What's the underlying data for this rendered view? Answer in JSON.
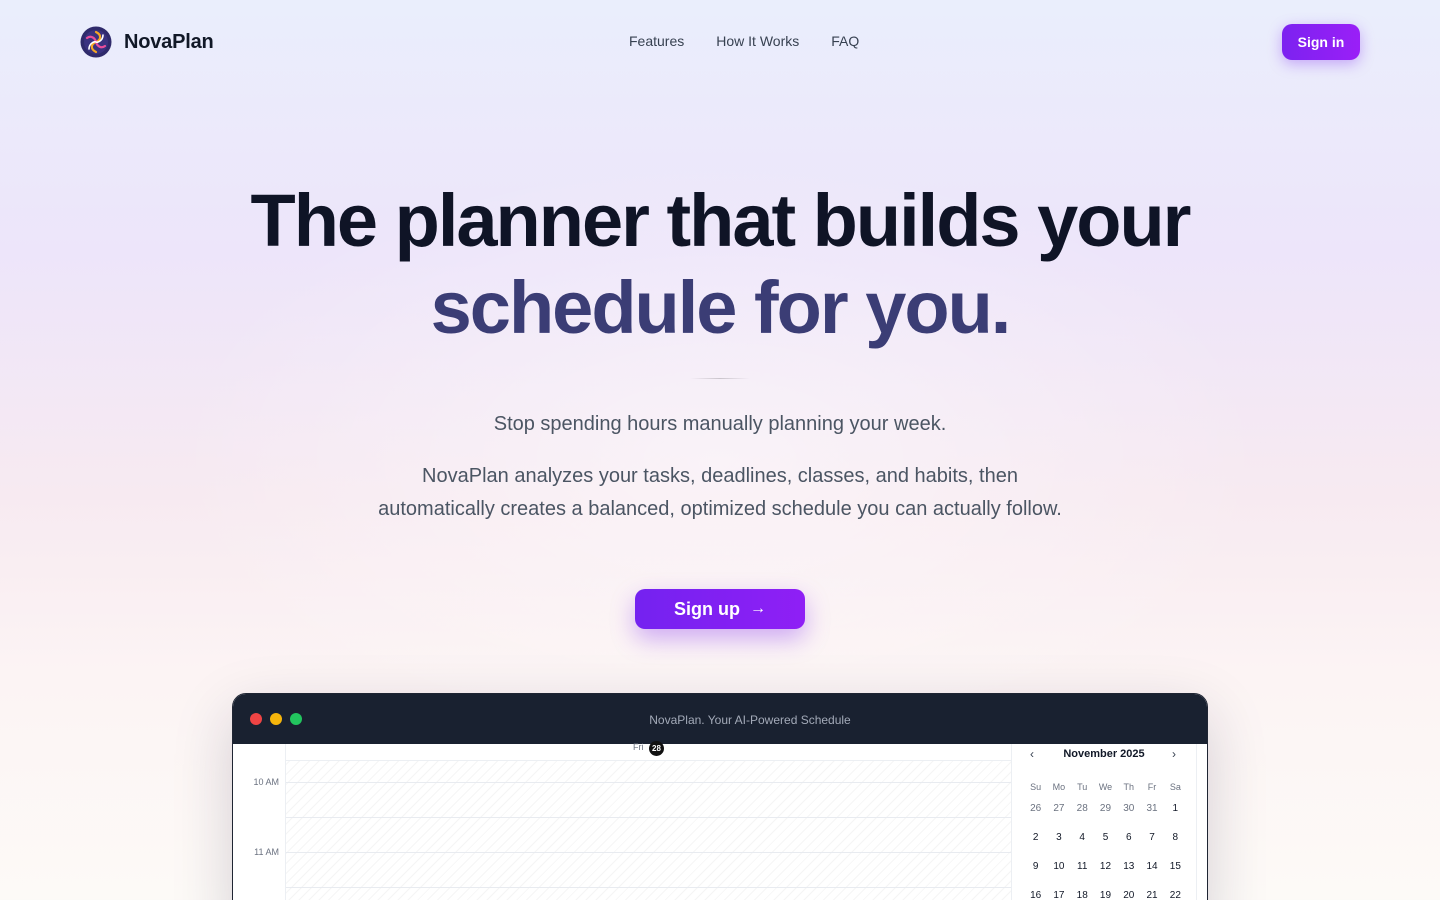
{
  "brand": {
    "name": "NovaPlan"
  },
  "nav": {
    "links": [
      "Features",
      "How It Works",
      "FAQ"
    ],
    "signin_label": "Sign in"
  },
  "hero": {
    "title_line1": "The planner that builds your",
    "title_line2": "schedule for you.",
    "subtitle": "Stop spending hours manually planning your week.",
    "description": "NovaPlan analyzes your tasks, deadlines, classes, and habits, then automatically creates a balanced, optimized schedule you can actually follow.",
    "cta_label": "Sign up",
    "cta_arrow": "→"
  },
  "app_window": {
    "title": "NovaPlan. Your AI-Powered Schedule",
    "day": {
      "name": "Fri",
      "number": "28"
    },
    "time_labels": [
      "10 AM",
      "11 AM"
    ],
    "calendar": {
      "month": "November 2025",
      "prev": "‹",
      "next": "›",
      "weekdays": [
        "Su",
        "Mo",
        "Tu",
        "We",
        "Th",
        "Fr",
        "Sa"
      ],
      "weeks": [
        [
          "26",
          "27",
          "28",
          "29",
          "30",
          "31",
          "1"
        ],
        [
          "2",
          "3",
          "4",
          "5",
          "6",
          "7",
          "8"
        ],
        [
          "9",
          "10",
          "11",
          "12",
          "13",
          "14",
          "15"
        ],
        [
          "16",
          "17",
          "18",
          "19",
          "20",
          "21",
          "22"
        ]
      ],
      "muted_in_first_week": 6
    }
  },
  "colors": {
    "accent": "#7c22f0",
    "heading": "#0f1426",
    "heading_secondary": "#3b3d75",
    "window_bar": "#192130"
  }
}
